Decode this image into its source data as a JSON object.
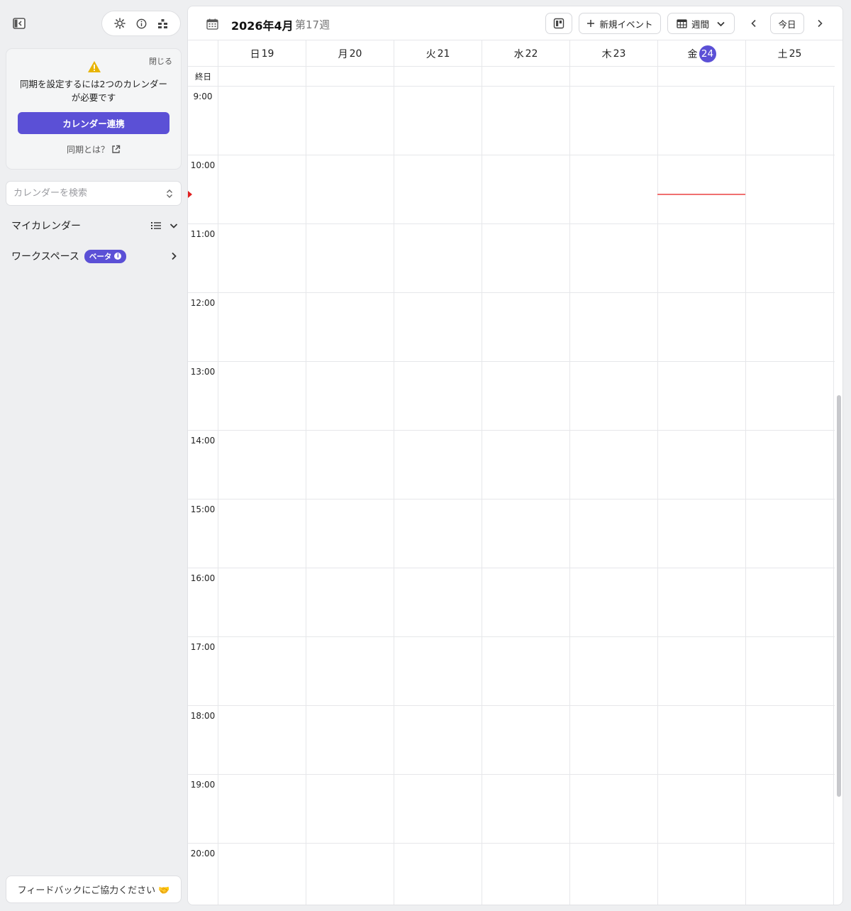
{
  "sidebar": {
    "sync_card": {
      "close_label": "閉じる",
      "message_line1": "同期を設定するには2つのカレンダー",
      "message_line2": "が必要です",
      "button_label": "カレンダー連携",
      "help_link": "同期とは？"
    },
    "search": {
      "placeholder": "カレンダーを検索"
    },
    "my_calendars_label": "マイカレンダー",
    "workspace_label": "ワークスペース",
    "beta_badge": "ベータ",
    "feedback_label": "フィードバックにご協力ください 🤝"
  },
  "header": {
    "month_title": "2026年4月",
    "week_label": "第17週",
    "new_event_label": "新規イベント",
    "view_label": "週間",
    "today_label": "今日"
  },
  "calendar": {
    "allday_label": "終日",
    "days": [
      {
        "weekday": "日",
        "date": "19",
        "is_today": false
      },
      {
        "weekday": "月",
        "date": "20",
        "is_today": false
      },
      {
        "weekday": "火",
        "date": "21",
        "is_today": false
      },
      {
        "weekday": "水",
        "date": "22",
        "is_today": false
      },
      {
        "weekday": "木",
        "date": "23",
        "is_today": false
      },
      {
        "weekday": "金",
        "date": "24",
        "is_today": true
      },
      {
        "weekday": "土",
        "date": "25",
        "is_today": false
      }
    ],
    "hours": [
      "9:00",
      "10:00",
      "11:00",
      "12:00",
      "13:00",
      "14:00",
      "15:00",
      "16:00",
      "17:00",
      "18:00",
      "19:00",
      "20:00"
    ],
    "current_time_day_index": 5,
    "current_time_hours": 10.57
  },
  "colors": {
    "accent": "#5b50d6",
    "now_line": "#f07070",
    "warning": "#e8b400"
  },
  "icons": [
    "sidebar-collapse-icon",
    "gear-icon",
    "info-icon",
    "tree-icon",
    "warning-icon",
    "external-link-icon",
    "unfold-icon",
    "list-icon",
    "chevron-down-icon",
    "chevron-right-icon",
    "calendar-icon",
    "board-icon",
    "plus-icon",
    "chevron-left-icon"
  ]
}
